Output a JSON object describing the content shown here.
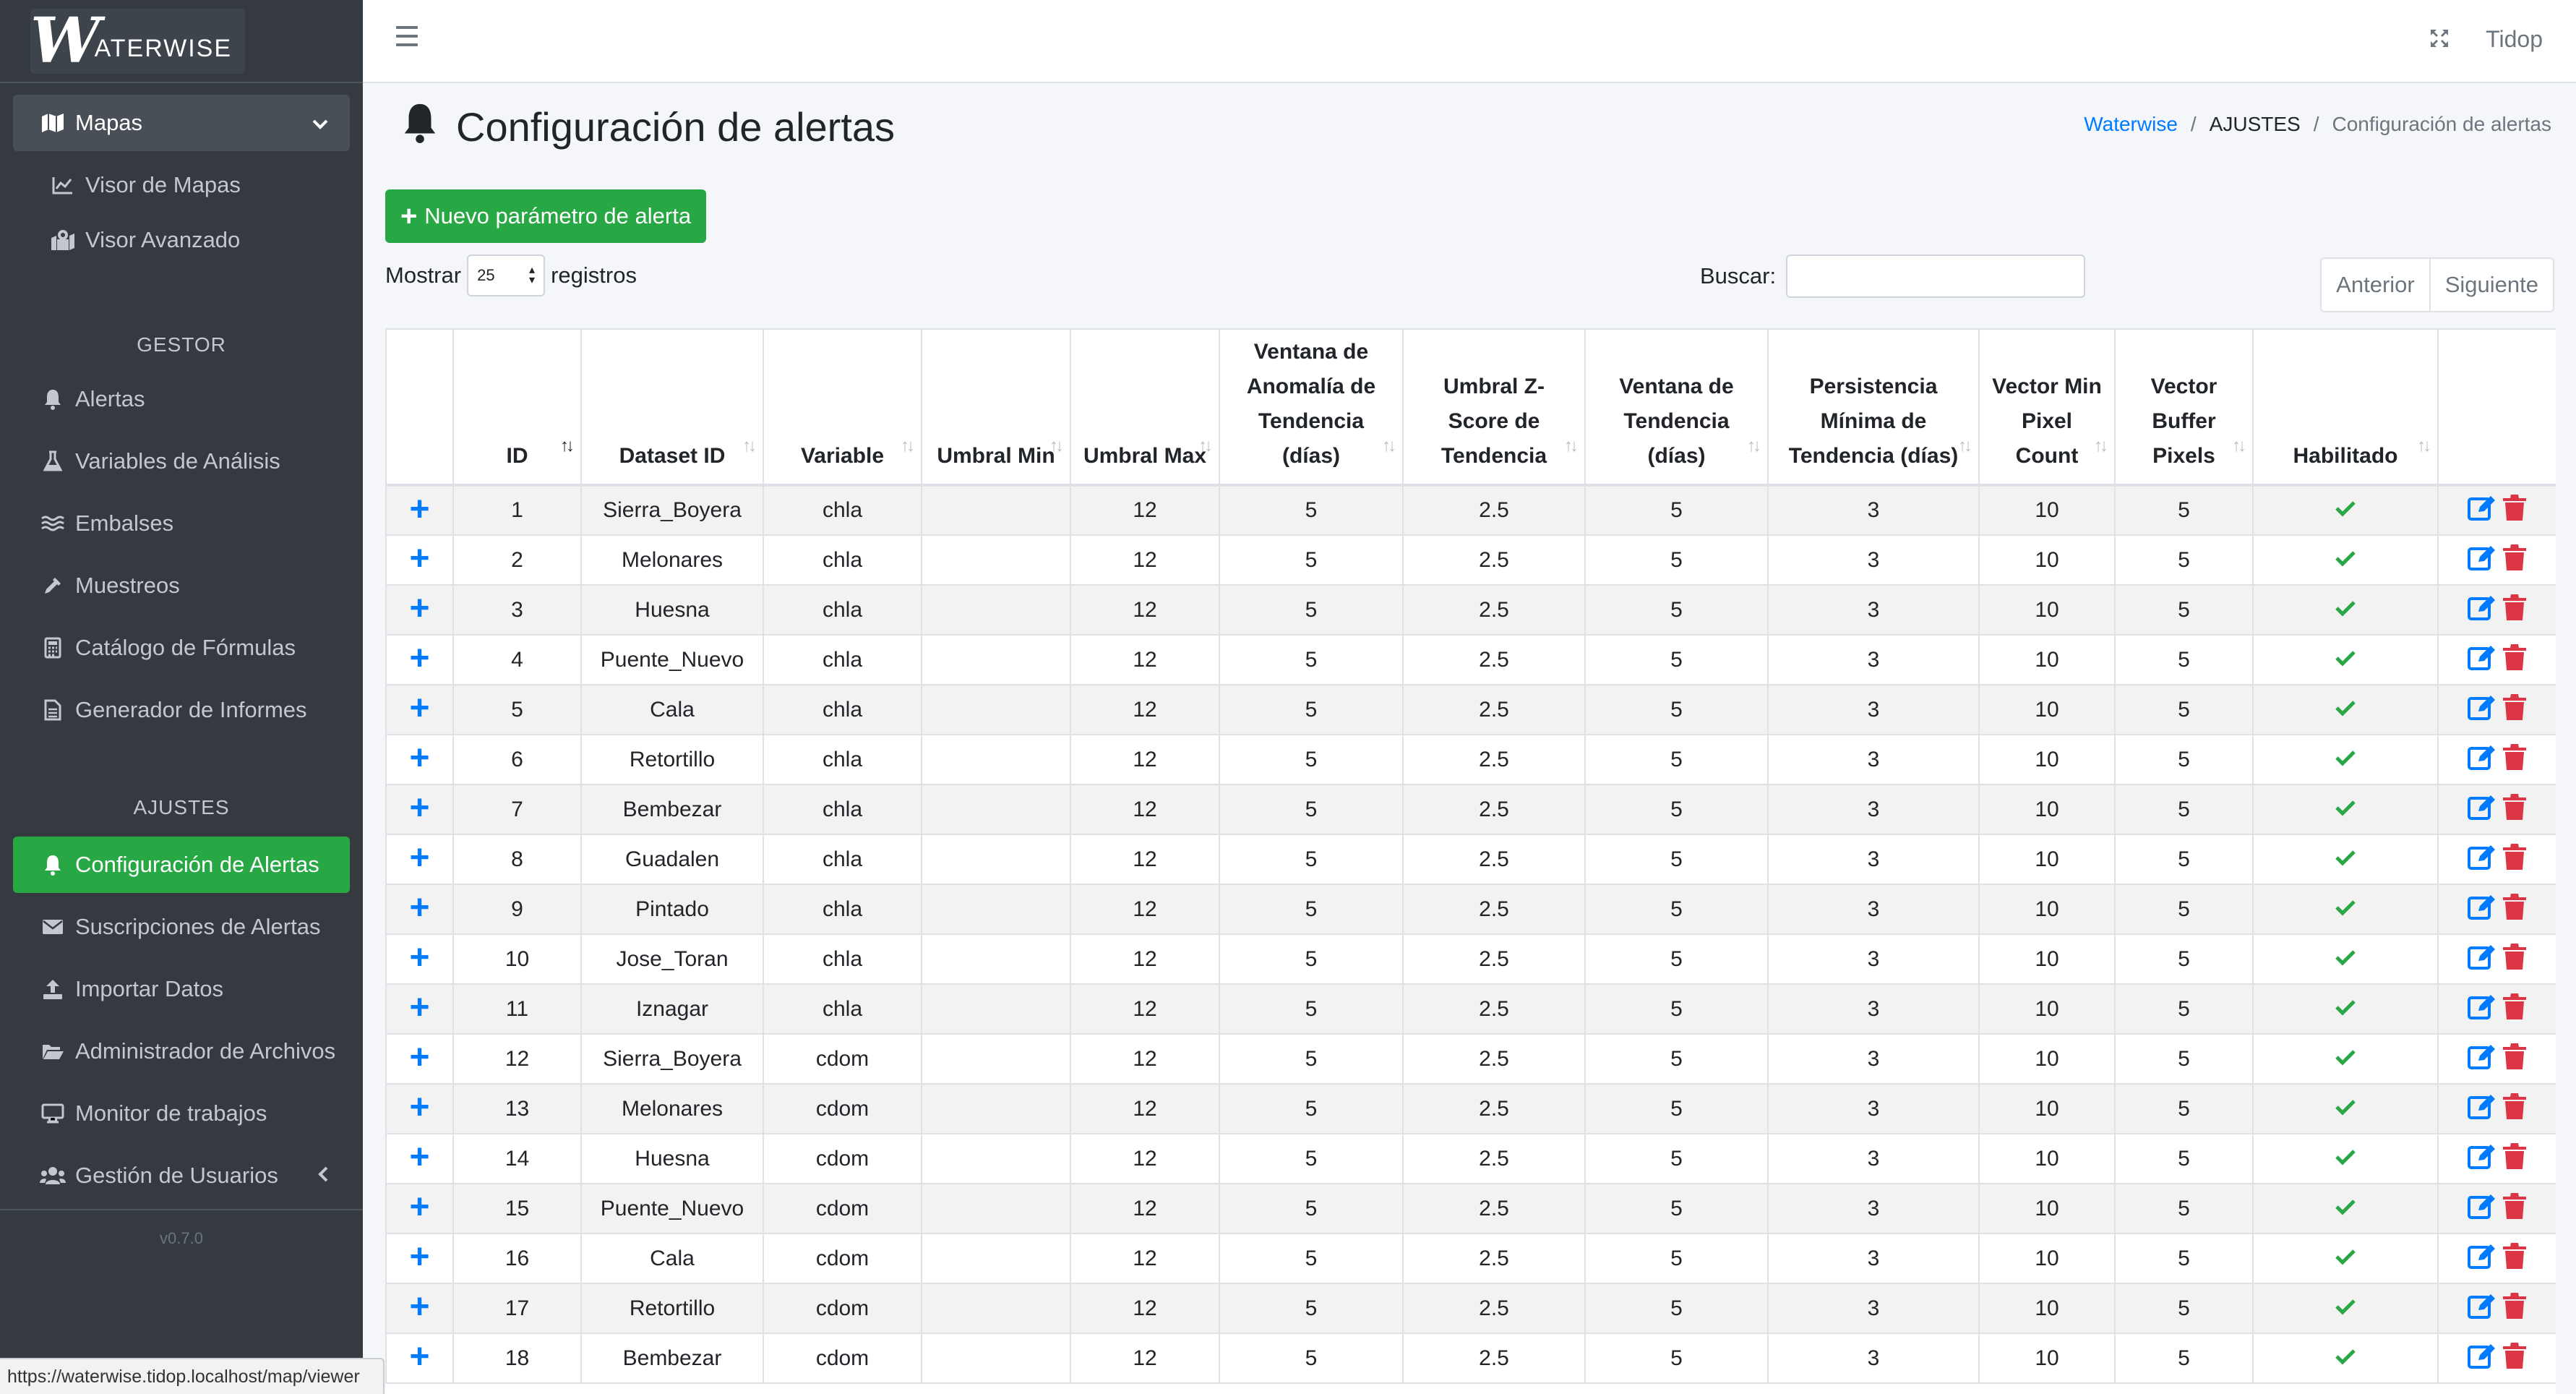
{
  "brand": {
    "letter": "W",
    "text": "ATERWISE"
  },
  "sidebar": {
    "mapas": "Mapas",
    "visor_mapas": "Visor de Mapas",
    "visor_avanzado": "Visor Avanzado",
    "header_gestor": "GESTOR",
    "alertas": "Alertas",
    "variables": "Variables de Análisis",
    "embalses": "Embalses",
    "muestreos": "Muestreos",
    "catalogo": "Catálogo de Fórmulas",
    "generador": "Generador de Informes",
    "header_ajustes": "AJUSTES",
    "config_alertas": "Configuración de Alertas",
    "suscripciones": "Suscripciones de Alertas",
    "importar": "Importar Datos",
    "administrador": "Administrador de Archivos",
    "monitor": "Monitor de trabajos",
    "gestion": "Gestión de Usuarios",
    "version": "v0.7.0"
  },
  "topbar": {
    "user": "Tidop"
  },
  "page": {
    "title": "Configuración de alertas"
  },
  "breadcrumb": {
    "home": "Waterwise",
    "sep": "/",
    "section": "AJUSTES",
    "current": "Configuración de alertas"
  },
  "toolbar": {
    "new_button": "Nuevo parámetro de alerta",
    "show_label": "Mostrar",
    "length_value": "25",
    "records_label": "registros",
    "search_label": "Buscar:",
    "search_value": "",
    "prev": "Anterior",
    "next": "Siguiente"
  },
  "table": {
    "headers": [
      "",
      "ID",
      "Dataset ID",
      "Variable",
      "Umbral Min",
      "Umbral Max",
      "Ventana de Anomalía de Tendencia (días)",
      "Umbral Z-Score de Tendencia",
      "Ventana de Tendencia (días)",
      "Persistencia Mínima de Tendencia (días)",
      "Vector Min Pixel Count",
      "Vector Buffer Pixels",
      "Habilitado",
      ""
    ],
    "rows": [
      {
        "id": "1",
        "dataset": "Sierra_Boyera",
        "variable": "chla",
        "min": "",
        "max": "12",
        "anom": "5",
        "z": "2.5",
        "win": "5",
        "pers": "3",
        "pix": "10",
        "buf": "5"
      },
      {
        "id": "2",
        "dataset": "Melonares",
        "variable": "chla",
        "min": "",
        "max": "12",
        "anom": "5",
        "z": "2.5",
        "win": "5",
        "pers": "3",
        "pix": "10",
        "buf": "5"
      },
      {
        "id": "3",
        "dataset": "Huesna",
        "variable": "chla",
        "min": "",
        "max": "12",
        "anom": "5",
        "z": "2.5",
        "win": "5",
        "pers": "3",
        "pix": "10",
        "buf": "5"
      },
      {
        "id": "4",
        "dataset": "Puente_Nuevo",
        "variable": "chla",
        "min": "",
        "max": "12",
        "anom": "5",
        "z": "2.5",
        "win": "5",
        "pers": "3",
        "pix": "10",
        "buf": "5"
      },
      {
        "id": "5",
        "dataset": "Cala",
        "variable": "chla",
        "min": "",
        "max": "12",
        "anom": "5",
        "z": "2.5",
        "win": "5",
        "pers": "3",
        "pix": "10",
        "buf": "5"
      },
      {
        "id": "6",
        "dataset": "Retortillo",
        "variable": "chla",
        "min": "",
        "max": "12",
        "anom": "5",
        "z": "2.5",
        "win": "5",
        "pers": "3",
        "pix": "10",
        "buf": "5"
      },
      {
        "id": "7",
        "dataset": "Bembezar",
        "variable": "chla",
        "min": "",
        "max": "12",
        "anom": "5",
        "z": "2.5",
        "win": "5",
        "pers": "3",
        "pix": "10",
        "buf": "5"
      },
      {
        "id": "8",
        "dataset": "Guadalen",
        "variable": "chla",
        "min": "",
        "max": "12",
        "anom": "5",
        "z": "2.5",
        "win": "5",
        "pers": "3",
        "pix": "10",
        "buf": "5"
      },
      {
        "id": "9",
        "dataset": "Pintado",
        "variable": "chla",
        "min": "",
        "max": "12",
        "anom": "5",
        "z": "2.5",
        "win": "5",
        "pers": "3",
        "pix": "10",
        "buf": "5"
      },
      {
        "id": "10",
        "dataset": "Jose_Toran",
        "variable": "chla",
        "min": "",
        "max": "12",
        "anom": "5",
        "z": "2.5",
        "win": "5",
        "pers": "3",
        "pix": "10",
        "buf": "5"
      },
      {
        "id": "11",
        "dataset": "Iznagar",
        "variable": "chla",
        "min": "",
        "max": "12",
        "anom": "5",
        "z": "2.5",
        "win": "5",
        "pers": "3",
        "pix": "10",
        "buf": "5"
      },
      {
        "id": "12",
        "dataset": "Sierra_Boyera",
        "variable": "cdom",
        "min": "",
        "max": "12",
        "anom": "5",
        "z": "2.5",
        "win": "5",
        "pers": "3",
        "pix": "10",
        "buf": "5"
      },
      {
        "id": "13",
        "dataset": "Melonares",
        "variable": "cdom",
        "min": "",
        "max": "12",
        "anom": "5",
        "z": "2.5",
        "win": "5",
        "pers": "3",
        "pix": "10",
        "buf": "5"
      },
      {
        "id": "14",
        "dataset": "Huesna",
        "variable": "cdom",
        "min": "",
        "max": "12",
        "anom": "5",
        "z": "2.5",
        "win": "5",
        "pers": "3",
        "pix": "10",
        "buf": "5"
      },
      {
        "id": "15",
        "dataset": "Puente_Nuevo",
        "variable": "cdom",
        "min": "",
        "max": "12",
        "anom": "5",
        "z": "2.5",
        "win": "5",
        "pers": "3",
        "pix": "10",
        "buf": "5"
      },
      {
        "id": "16",
        "dataset": "Cala",
        "variable": "cdom",
        "min": "",
        "max": "12",
        "anom": "5",
        "z": "2.5",
        "win": "5",
        "pers": "3",
        "pix": "10",
        "buf": "5"
      },
      {
        "id": "17",
        "dataset": "Retortillo",
        "variable": "cdom",
        "min": "",
        "max": "12",
        "anom": "5",
        "z": "2.5",
        "win": "5",
        "pers": "3",
        "pix": "10",
        "buf": "5"
      },
      {
        "id": "18",
        "dataset": "Bembezar",
        "variable": "cdom",
        "min": "",
        "max": "12",
        "anom": "5",
        "z": "2.5",
        "win": "5",
        "pers": "3",
        "pix": "10",
        "buf": "5"
      }
    ]
  },
  "statusbar": {
    "url": "https://waterwise.tidop.localhost/map/viewer"
  },
  "colors": {
    "sidebar_bg": "#343a40",
    "accent_green": "#28a745",
    "link_blue": "#007bff",
    "delete_red": "#dc3545"
  }
}
